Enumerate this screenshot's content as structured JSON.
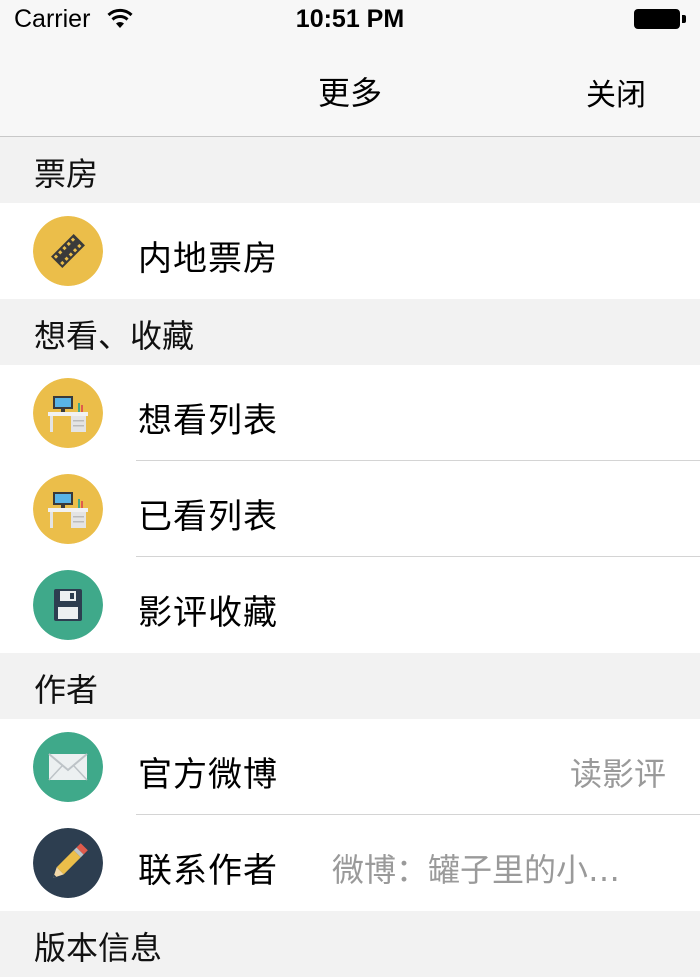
{
  "status_bar": {
    "carrier": "Carrier",
    "time": "10:51 PM"
  },
  "nav": {
    "title": "更多",
    "close_label": "关闭"
  },
  "sections": [
    {
      "header": "票房",
      "rows": [
        {
          "label": "内地票房",
          "icon": "film-reel-icon",
          "icon_bg": "#EBBE4A"
        }
      ]
    },
    {
      "header": "想看、收藏",
      "rows": [
        {
          "label": "想看列表",
          "icon": "desk-computer-icon",
          "icon_bg": "#EBBE4A"
        },
        {
          "label": "已看列表",
          "icon": "desk-computer-icon",
          "icon_bg": "#EBBE4A"
        },
        {
          "label": "影评收藏",
          "icon": "floppy-disk-icon",
          "icon_bg": "#3FA98A"
        }
      ]
    },
    {
      "header": "作者",
      "rows": [
        {
          "label": "官方微博",
          "detail": "读影评",
          "icon": "envelope-icon",
          "icon_bg": "#3FA98A"
        },
        {
          "label": "联系作者",
          "detail": "微博：罐子里的小…",
          "icon": "pencil-icon",
          "icon_bg": "#2D3E50"
        }
      ]
    },
    {
      "header": "版本信息",
      "rows": []
    }
  ]
}
